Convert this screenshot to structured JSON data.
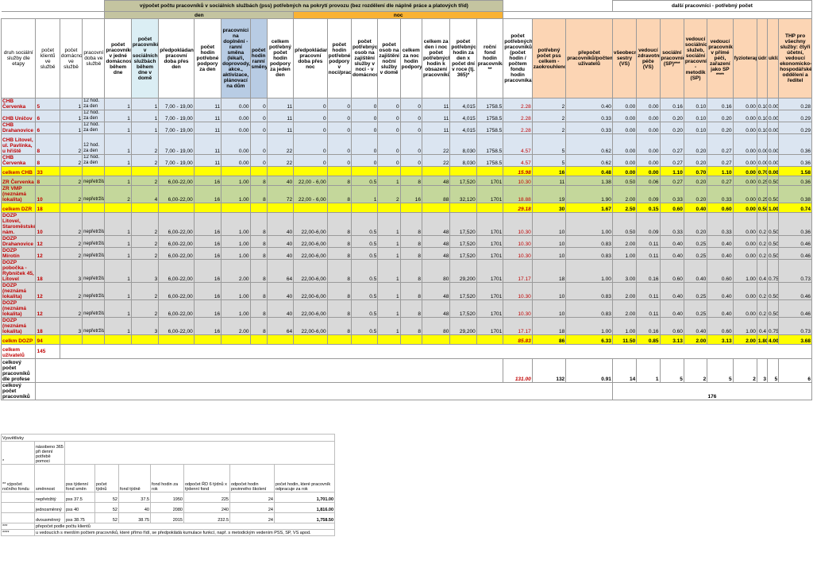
{
  "header": {
    "top_title": "výpočet počtu pracovníků v sociálních službách (pss) potřebných na pokrytí provozu (bez rozdělení dle náplně práce a platových tříd)",
    "right_title": "další pracovníci - potřebný počet",
    "den": "den",
    "noc": "noc",
    "cols": [
      "druh sociální služby dle etapy",
      "počet klientů ve službě",
      "počet domácností ve službě",
      "pracovní doba ve službě",
      "počet pracovníků v jedné domácnosti během dne",
      "počet pracovníků v sociálních službách během dne v domě",
      "předpokládaná pracovní doba přes den",
      "počet hodin potřebné podpory za den",
      "pracovníci na doplnění - ranní směna (lékaři, doprovody, akce., aktivizace, plánovací na dům",
      "počet hodin ranní směny",
      "celkem potřebný počet hodin podpory za jeden den",
      "předpokládaná pracovní doba přes noc",
      "počet hodin potřebné podpory v noci/prac.",
      "počet potřebných osob na zajištění služby v noci - v domácnosti",
      "počet osob na zajištění noční služby v domě",
      "celkem za noc hodin podpory",
      "celkem za den i noc počet potřebných hodin k obsazení pracovníků",
      "počet potřebných hodin za den x počet dní v roce (tj. 365)*",
      "roční fond hodin pracovníka **",
      "počet potřebných pracovníků (počet hodin / počtem fondu hodin pracovníka)",
      "potřebný počet pss celkem - zaokrouhleno",
      "přepočet pracovníků/počtem uživatelů",
      "všeobecné sestry (VS)",
      "vedoucí zdravotní péče (VS)",
      "sociální pracovníci (SP)***",
      "vedoucí sociálních služeb, sociální pracovník - metodik (SP)",
      "vedoucí pracovníků v přímé péči, zařazení jako SP ****",
      "fyzioterapeut",
      "údržbář",
      "uklízeč",
      "THP pro všechny služby: čtyři účetní, vedoucí ekonomicko-hospodářského oddělení a ředitel"
    ]
  },
  "rows": [
    {
      "g": "blue",
      "c": [
        "CHB Červenka",
        "5",
        "1",
        "12 hod. za den",
        "1",
        "1",
        "7,00 - 19,00",
        "11",
        "0.00",
        "0",
        "11",
        "0",
        "0",
        "0",
        "0",
        "0",
        "11",
        "4,015",
        "1758.5",
        "2.28",
        "2",
        "0.40",
        "0.00",
        "0.00",
        "0.16",
        "0.10",
        "0.16",
        "0.00",
        "0.10",
        "0.00",
        "0.28"
      ]
    },
    {
      "g": "blue",
      "c": [
        "CHB Uničov",
        "6",
        "1",
        "12 hod. za den",
        "1",
        "1",
        "7,00 - 19,00",
        "11",
        "0.00",
        "0",
        "11",
        "0",
        "0",
        "0",
        "0",
        "0",
        "11",
        "4,015",
        "1758.5",
        "2.28",
        "2",
        "0.33",
        "0.00",
        "0.00",
        "0.20",
        "0.10",
        "0.20",
        "0.00",
        "0.10",
        "0.00",
        "0.29"
      ]
    },
    {
      "g": "blue",
      "c": [
        "CHB Drahanovice",
        "6",
        "1",
        "12 hod. za den",
        "1",
        "1",
        "7,00 - 19,00",
        "11",
        "0.00",
        "0",
        "11",
        "0",
        "0",
        "0",
        "0",
        "0",
        "11",
        "4,015",
        "1758.5",
        "2.28",
        "2",
        "0.33",
        "0.00",
        "0.00",
        "0.20",
        "0.10",
        "0.20",
        "0.00",
        "0.10",
        "0.00",
        "0.29"
      ]
    },
    {
      "g": "blue",
      "c": [
        "CHB Litovel, ul. Pavlínka, u hřiště",
        "8",
        "2",
        "12 hod. za den",
        "1",
        "2",
        "7,00 - 19,00",
        "11",
        "0.00",
        "0",
        "22",
        "0",
        "0",
        "0",
        "0",
        "0",
        "22",
        "8,030",
        "1758.5",
        "4.57",
        "5",
        "0.62",
        "0.00",
        "0.00",
        "0.27",
        "0.20",
        "0.27",
        "0.00",
        "0.00",
        "0.00",
        "0.36"
      ]
    },
    {
      "g": "blue",
      "c": [
        "CHB Červenka",
        "8",
        "2",
        "12 hod. za den",
        "1",
        "2",
        "7,00 - 19,00",
        "11",
        "0.00",
        "0",
        "22",
        "0",
        "0",
        "0",
        "0",
        "0",
        "22",
        "8,030",
        "1758.5",
        "4.57",
        "5",
        "0.62",
        "0.00",
        "0.00",
        "0.27",
        "0.20",
        "0.27",
        "0.00",
        "0.00",
        "0.00",
        "0.36"
      ]
    },
    {
      "g": "yellow",
      "c": [
        "celkem CHB",
        "33",
        "",
        "",
        "",
        "",
        "",
        "",
        "",
        "",
        "",
        "",
        "",
        "",
        "",
        "",
        "",
        "",
        "",
        "15.98",
        "16",
        "0.48",
        "0.00",
        "0.00",
        "1.10",
        "0.70",
        "1.10",
        "0.00",
        "0.70",
        "0.00",
        "1.58"
      ]
    },
    {
      "g": "green",
      "c": [
        "ZR Červenka",
        "8",
        "2",
        "nepřetržitá",
        "1",
        "2",
        "6,00-22,00",
        "16",
        "1.00",
        "8",
        "40",
        "22,00 - 6,00",
        "8",
        "0.5",
        "1",
        "8",
        "48",
        "17,520",
        "1701",
        "10.30",
        "11",
        "1.38",
        "0.50",
        "0.06",
        "0.27",
        "0.20",
        "0.27",
        "0.00",
        "0.25",
        "0.50",
        "0.36"
      ]
    },
    {
      "g": "green",
      "c": [
        "ZR VMP (neznámá lokalita)",
        "10",
        "2",
        "nepřetržitá",
        "2",
        "4",
        "6,00-22,00",
        "16",
        "1.00",
        "8",
        "72",
        "22,00 - 6,00",
        "8",
        "1",
        "2",
        "16",
        "88",
        "32,120",
        "1701",
        "18.88",
        "19",
        "1.90",
        "2.00",
        "0.09",
        "0.33",
        "0.20",
        "0.33",
        "0.00",
        "0.25",
        "0.50",
        "0.38"
      ]
    },
    {
      "g": "yellow",
      "c": [
        "celkem DZR",
        "18",
        "",
        "",
        "",
        "",
        "",
        "",
        "",
        "",
        "",
        "",
        "",
        "",
        "",
        "",
        "",
        "",
        "",
        "29.18",
        "30",
        "1.67",
        "2.50",
        "0.15",
        "0.60",
        "0.40",
        "0.60",
        "0.00",
        "0.50",
        "1.00",
        "0.74"
      ]
    },
    {
      "g": "gray",
      "c": [
        "DOZP Litovel, Staroměstské nám.",
        "10",
        "2",
        "nepřetržitá",
        "1",
        "2",
        "6,00-22,00",
        "16",
        "1.00",
        "8",
        "40",
        "22,00-6,00",
        "8",
        "0.5",
        "1",
        "8",
        "48",
        "17,520",
        "1701",
        "10.30",
        "10",
        "1.00",
        "0.50",
        "0.09",
        "0.33",
        "0.20",
        "0.33",
        "0.00",
        "0.2",
        "0.50",
        "0.36"
      ]
    },
    {
      "g": "gray",
      "c": [
        "DOZP Drahanovice",
        "12",
        "2",
        "nepřetržitá",
        "1",
        "2",
        "6,00-22,00",
        "16",
        "1.00",
        "8",
        "40",
        "22,00-6,00",
        "8",
        "0.5",
        "1",
        "8",
        "48",
        "17,520",
        "1701",
        "10.30",
        "10",
        "0.83",
        "2.00",
        "0.11",
        "0.40",
        "0.25",
        "0.40",
        "0.00",
        "0.2",
        "0.50",
        "0.46"
      ]
    },
    {
      "g": "gray",
      "c": [
        "DOZP Mírotín",
        "12",
        "2",
        "nepřetržitá",
        "1",
        "2",
        "6,00-22,00",
        "16",
        "1.00",
        "8",
        "40",
        "22,00-6,00",
        "8",
        "0.5",
        "1",
        "8",
        "48",
        "17,520",
        "1701",
        "10.30",
        "10",
        "0.83",
        "1.00",
        "0.11",
        "0.40",
        "0.25",
        "0.40",
        "0.00",
        "0.2",
        "0.50",
        "0.46"
      ]
    },
    {
      "g": "gray",
      "c": [
        "DOZP pobočka - Rybníček 45, Litovel",
        "18",
        "3",
        "nepřetržitá",
        "1",
        "3",
        "6,00-22,00",
        "16",
        "2.00",
        "8",
        "64",
        "22,00-6,00",
        "8",
        "0.5",
        "1",
        "8",
        "80",
        "29,200",
        "1701",
        "17.17",
        "18",
        "1.00",
        "3.00",
        "0.16",
        "0.60",
        "0.40",
        "0.60",
        "1.00",
        "0.4",
        "0.75",
        "0.73"
      ]
    },
    {
      "g": "gray",
      "c": [
        "DOZP (neznámá lokalita)",
        "12",
        "2",
        "nepřetržitá",
        "1",
        "2",
        "6,00-22,00",
        "16",
        "1.00",
        "8",
        "40",
        "22,00-6,00",
        "8",
        "0.5",
        "1",
        "8",
        "48",
        "17,520",
        "1701",
        "10.30",
        "10",
        "0.83",
        "2.00",
        "0.11",
        "0.40",
        "0.25",
        "0.40",
        "0.00",
        "0.2",
        "0.50",
        "0.46"
      ]
    },
    {
      "g": "gray",
      "c": [
        "DOZP (neznámá lokalita)",
        "12",
        "2",
        "nepřetržitá",
        "1",
        "2",
        "6,00-22,00",
        "16",
        "1.00",
        "8",
        "40",
        "22,00-6,00",
        "8",
        "0.5",
        "1",
        "8",
        "48",
        "17,520",
        "1701",
        "10.30",
        "10",
        "0.83",
        "2.00",
        "0.11",
        "0.40",
        "0.25",
        "0.40",
        "0.00",
        "0.2",
        "0.50",
        "0.46"
      ]
    },
    {
      "g": "gray",
      "c": [
        "DOZP (neznámá lokalita)",
        "18",
        "3",
        "nepřetržitá",
        "1",
        "3",
        "6,00-22,00",
        "16",
        "2.00",
        "8",
        "64",
        "22,00-6,00",
        "8",
        "0.5",
        "1",
        "8",
        "80",
        "29,200",
        "1701",
        "17.17",
        "18",
        "1.00",
        "1.00",
        "0.16",
        "0.60",
        "0.40",
        "0.60",
        "1.00",
        "0.4",
        "0.75",
        "0.73"
      ]
    },
    {
      "g": "yellow",
      "c": [
        "celkm DOZP",
        "94",
        "",
        "",
        "",
        "",
        "",
        "",
        "",
        "",
        "",
        "",
        "",
        "",
        "",
        "",
        "",
        "",
        "",
        "85.83",
        "86",
        "6.33",
        "11.50",
        "0.85",
        "3.13",
        "2.00",
        "3.13",
        "2.00",
        "1.80",
        "4.00",
        "3.68"
      ]
    }
  ],
  "summary": {
    "users_label": "celkem uživatelů",
    "users_value": "145",
    "profession_label": "celkový počet pracovníků dle profese",
    "profession_values": [
      "131.00",
      "132",
      "0.91",
      "14",
      "1",
      "5",
      "2",
      "5",
      "2",
      "3",
      "5",
      "6"
    ],
    "total_label": "celkový počet pracovníků",
    "total_value": "176"
  },
  "notes": {
    "title": "Vysvětlivky",
    "star1": "*",
    "star1_text": "násobeno 365 při denní potřebě pomoci",
    "star2_label": "** výpočet ročního fondu",
    "fund_headers": [
      "směnnost",
      "pss týdenní fond směn",
      "počet týdnů",
      "fond týdně",
      "fond hodin za rok",
      "odpočet ŘD 6 týdnů x týdenní fond",
      "odpočet hodin povinného školení",
      "počet hodin, které pracovník odpracuje za rok"
    ],
    "fund_rows": [
      [
        "nepřetržitý",
        "pss 37.5",
        "52",
        "37.5",
        "1950",
        "225",
        "24",
        "1,701.00"
      ],
      [
        "jednosměnný",
        "pss 40",
        "52",
        "40",
        "2080",
        "240",
        "24",
        "1,816.00"
      ],
      [
        "dvousměnný",
        "pss 38.75",
        "52",
        "38.75",
        "2015",
        "232.5",
        "24",
        "1,758.50"
      ]
    ],
    "star3": "***",
    "star3_text": "přepočet podle počtu klientů",
    "star4": "****",
    "star4_text": "u vedoucích s menším počtem pracovníků, které přímo řídí, se předpokládá kumulace funkcí, např. s metodickým vedením PSS, SP, VS apod."
  }
}
